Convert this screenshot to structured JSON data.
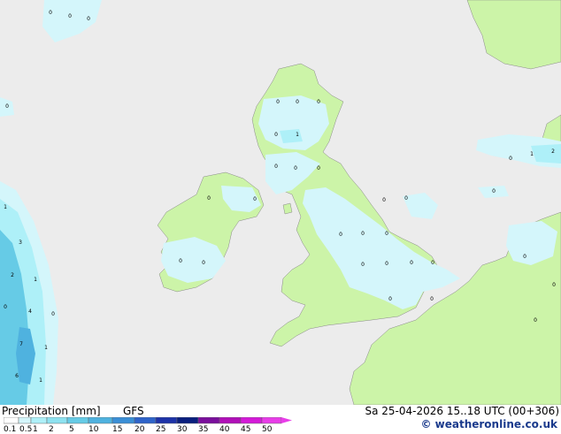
{
  "footer": {
    "title": "Precipitation [mm]",
    "model": "GFS",
    "run_info": "Sa 25-04-2026 15..18 UTC (00+306)",
    "credit": "© weatheronline.co.uk"
  },
  "legend": {
    "ticks": [
      "0.1",
      "0.5",
      "1",
      "2",
      "5",
      "10",
      "15",
      "20",
      "25",
      "30",
      "35",
      "40",
      "45",
      "50"
    ],
    "colors": [
      "#ffffff",
      "#d4f6fb",
      "#aef0f8",
      "#8ee2f0",
      "#66cbe6",
      "#4fb2df",
      "#3b8fd6",
      "#2f64c9",
      "#1e33a8",
      "#0a1f7e",
      "#7a0f9c",
      "#b00fb8",
      "#d41ad8",
      "#e83de8"
    ]
  },
  "map": {
    "sea_color": "#ececec",
    "land_color": "#ccf4a8",
    "precip_light": "#d4f6fb",
    "precip_mid": "#aef0f8",
    "precip_heavy": "#66cbe6",
    "precip_values": [
      {
        "name": "val-nw-1",
        "text": "0"
      },
      {
        "name": "val-nw-2",
        "text": "0"
      },
      {
        "name": "val-nw-3",
        "text": "0"
      },
      {
        "name": "val-atl-1",
        "text": "0"
      },
      {
        "name": "val-scot-1",
        "text": "0"
      },
      {
        "name": "val-scot-2",
        "text": "0"
      },
      {
        "name": "val-scot-3",
        "text": "0"
      },
      {
        "name": "val-scot-4",
        "text": "0"
      },
      {
        "name": "val-scot-5",
        "text": "1"
      },
      {
        "name": "val-scot-6",
        "text": "0"
      },
      {
        "name": "val-scot-7",
        "text": "0"
      },
      {
        "name": "val-scot-8",
        "text": "0"
      },
      {
        "name": "val-ne-1",
        "text": "0"
      },
      {
        "name": "val-ne-2",
        "text": "0"
      },
      {
        "name": "val-north-sea-1",
        "text": "0"
      },
      {
        "name": "val-den-1",
        "text": "0"
      },
      {
        "name": "val-den-2",
        "text": "1"
      },
      {
        "name": "val-den-3",
        "text": "2"
      },
      {
        "name": "val-irl-1",
        "text": "0"
      },
      {
        "name": "val-irl-2",
        "text": "0"
      },
      {
        "name": "val-irl-3",
        "text": "0"
      },
      {
        "name": "val-irl-4",
        "text": "0"
      },
      {
        "name": "val-eng-1",
        "text": "0"
      },
      {
        "name": "val-eng-2",
        "text": "0"
      },
      {
        "name": "val-eng-3",
        "text": "0"
      },
      {
        "name": "val-eng-4",
        "text": "0"
      },
      {
        "name": "val-eng-5",
        "text": "0"
      },
      {
        "name": "val-eng-6",
        "text": "0"
      },
      {
        "name": "val-eng-7",
        "text": "0"
      },
      {
        "name": "val-eng-8",
        "text": "0"
      },
      {
        "name": "val-eng-9",
        "text": "0"
      },
      {
        "name": "val-nl-1",
        "text": "0"
      },
      {
        "name": "val-nl-2",
        "text": "0"
      },
      {
        "name": "val-fr-1",
        "text": "0"
      },
      {
        "name": "val-atl-2",
        "text": "1"
      },
      {
        "name": "val-atl-3",
        "text": "3"
      },
      {
        "name": "val-atl-4",
        "text": "2"
      },
      {
        "name": "val-atl-5",
        "text": "1"
      },
      {
        "name": "val-atl-6",
        "text": "0"
      },
      {
        "name": "val-atl-7",
        "text": "4"
      },
      {
        "name": "val-atl-8",
        "text": "0"
      },
      {
        "name": "val-atl-9",
        "text": "7"
      },
      {
        "name": "val-atl-10",
        "text": "1"
      },
      {
        "name": "val-atl-11",
        "text": "6"
      },
      {
        "name": "val-atl-12",
        "text": "1"
      }
    ]
  }
}
